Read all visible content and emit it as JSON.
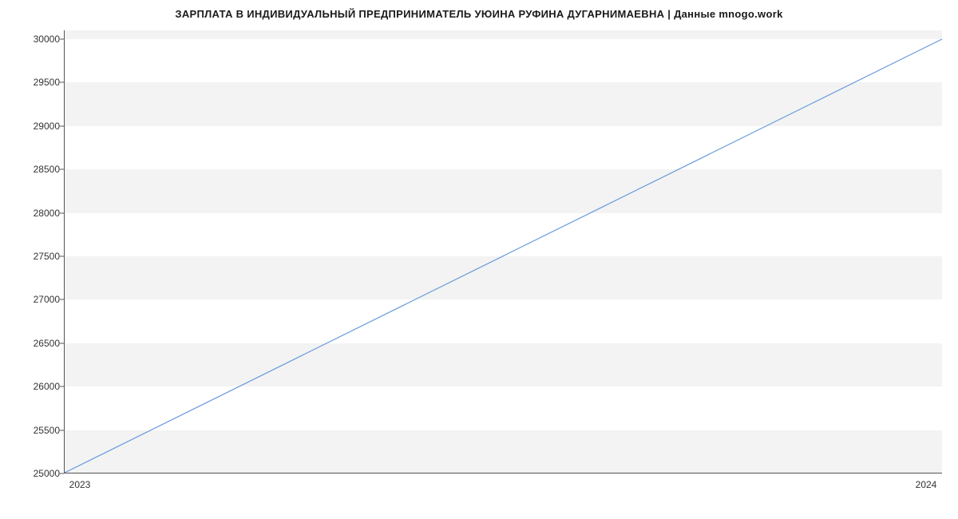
{
  "chart_data": {
    "type": "line",
    "title": "ЗАРПЛАТА В ИНДИВИДУАЛЬНЫЙ ПРЕДПРИНИМАТЕЛЬ УЮИНА РУФИНА ДУГАРНИМАЕВНА | Данные mnogo.work",
    "xlabel": "",
    "ylabel": "",
    "x": [
      2023,
      2024
    ],
    "values": [
      25000,
      30000
    ],
    "x_ticks": [
      "2023",
      "2024"
    ],
    "y_ticks": [
      25000,
      25500,
      26000,
      26500,
      27000,
      27500,
      28000,
      28500,
      29000,
      29500,
      30000
    ],
    "ylim": [
      25000,
      30100
    ],
    "xlim": [
      2023,
      2024
    ],
    "grid_bands": true,
    "line_color": "#6699dd"
  }
}
